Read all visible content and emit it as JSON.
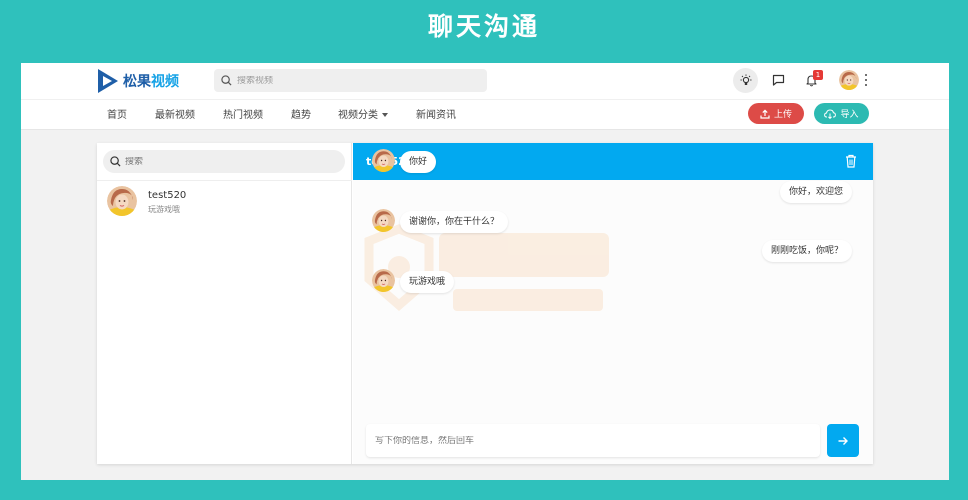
{
  "banner": {
    "title": "聊天沟通"
  },
  "header": {
    "logo_a": "松果",
    "logo_b": "视频",
    "search_placeholder": "搜索视频",
    "notification_count": "1"
  },
  "nav": {
    "items": [
      "首页",
      "最新视频",
      "热门视频",
      "趋势",
      "视频分类",
      "新闻资讯"
    ],
    "upload_label": "上传",
    "import_label": "导入"
  },
  "contacts": {
    "search_placeholder": "搜索",
    "list": [
      {
        "name": "test520",
        "last_message": "玩游戏哦"
      }
    ]
  },
  "conversation": {
    "title": "test520",
    "messages": [
      {
        "side": "left",
        "text": "你好"
      },
      {
        "side": "right",
        "text": "你好，欢迎您"
      },
      {
        "side": "left",
        "text": "谢谢你，你在干什么？"
      },
      {
        "side": "right",
        "text": "刚刚吃饭，你呢？"
      },
      {
        "side": "left",
        "text": "玩游戏哦"
      }
    ],
    "input_placeholder": "写下你的信息，然后回车"
  },
  "colors": {
    "background": "#2fc1bc",
    "accent_blue": "#02a9f0",
    "upload_red": "#dd4b47",
    "import_teal": "#2cbab2",
    "badge_red": "#e53935"
  }
}
